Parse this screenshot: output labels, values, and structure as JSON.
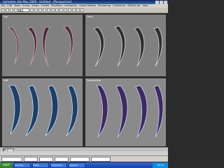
{
  "window": {
    "title": "Autodesk 3ds Max 2009 - Untitled - [Perspective]"
  },
  "menubar": {
    "items": [
      "File",
      "Edit",
      "Tools",
      "Group",
      "Views",
      "Create",
      "Modifiers",
      "Animation",
      "Graph Editors",
      "Rendering",
      "Customize",
      "MAXScript",
      "Help"
    ]
  },
  "toolbar": {
    "selection_filter": "All"
  },
  "viewports": {
    "top_left": "Top",
    "top_right": "Front",
    "bottom_left": "Left",
    "bottom_right": "Perspective"
  },
  "timeslider": {
    "value": "0 / 100"
  },
  "taskbar": {
    "start_label": "start",
    "tasks": [
      "3ds Max",
      "Folder",
      "Photoshop",
      "Explorer"
    ],
    "clock": "10:24"
  }
}
